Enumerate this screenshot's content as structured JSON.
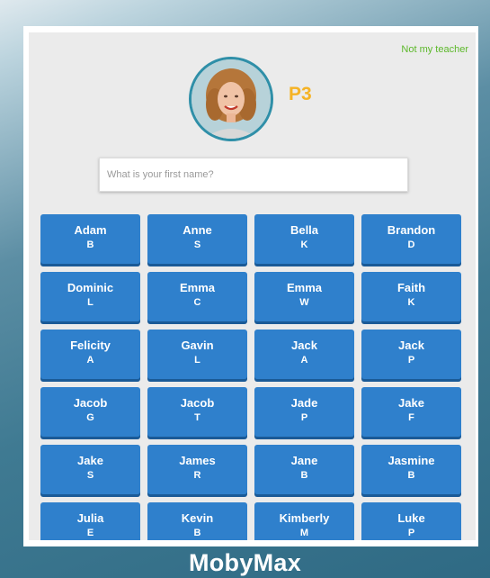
{
  "header": {
    "not_my_teacher_link": "Not my teacher",
    "class_code": "P3"
  },
  "search": {
    "placeholder": "What is your first name?",
    "value": ""
  },
  "students": [
    {
      "first": "Adam",
      "last": "B"
    },
    {
      "first": "Anne",
      "last": "S"
    },
    {
      "first": "Bella",
      "last": "K"
    },
    {
      "first": "Brandon",
      "last": "D"
    },
    {
      "first": "Dominic",
      "last": "L"
    },
    {
      "first": "Emma",
      "last": "C"
    },
    {
      "first": "Emma",
      "last": "W"
    },
    {
      "first": "Faith",
      "last": "K"
    },
    {
      "first": "Felicity",
      "last": "A"
    },
    {
      "first": "Gavin",
      "last": "L"
    },
    {
      "first": "Jack",
      "last": "A"
    },
    {
      "first": "Jack",
      "last": "P"
    },
    {
      "first": "Jacob",
      "last": "G"
    },
    {
      "first": "Jacob",
      "last": "T"
    },
    {
      "first": "Jade",
      "last": "P"
    },
    {
      "first": "Jake",
      "last": "F"
    },
    {
      "first": "Jake",
      "last": "S"
    },
    {
      "first": "James",
      "last": "R"
    },
    {
      "first": "Jane",
      "last": "B"
    },
    {
      "first": "Jasmine",
      "last": "B"
    },
    {
      "first": "Julia",
      "last": "E"
    },
    {
      "first": "Kevin",
      "last": "B"
    },
    {
      "first": "Kimberly",
      "last": "M"
    },
    {
      "first": "Luke",
      "last": "P"
    }
  ],
  "footer": {
    "title": "MobyMax"
  },
  "colors": {
    "button_blue": "#2f80cc",
    "class_code_yellow": "#f5b325",
    "link_green": "#5cb82a"
  },
  "icons": {
    "avatar": "teacher-avatar-photo"
  }
}
